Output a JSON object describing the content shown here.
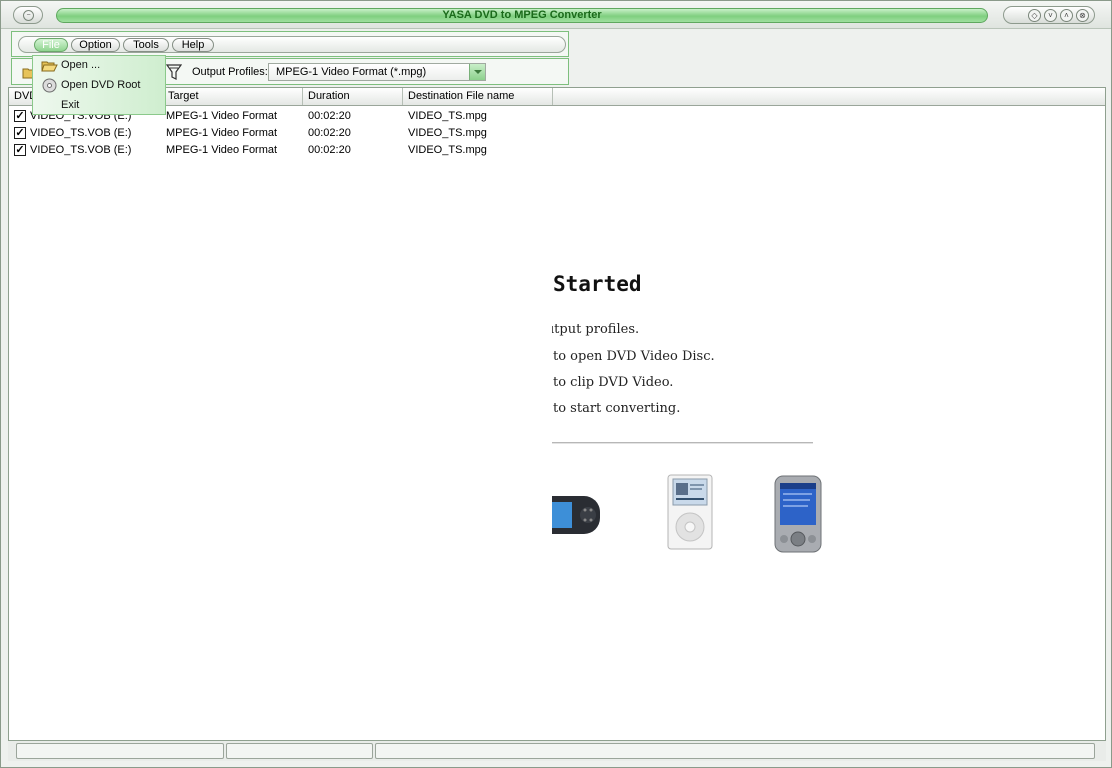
{
  "window": {
    "title": "YASA DVD to MPEG Converter",
    "controls": [
      "sys-menu",
      "minimize",
      "maximize",
      "restore",
      "close"
    ]
  },
  "menu": {
    "file": "File",
    "option": "Option",
    "tools": "Tools",
    "help": "Help"
  },
  "file_menu": {
    "items": [
      "Open ...",
      "Open DVD Root",
      "Exit"
    ]
  },
  "toolbar": {
    "profiles_label": "Output Profiles:",
    "profiles_value": "MPEG-1 Video Format (*.mpg)"
  },
  "list": {
    "columns": [
      "DVD",
      "Target",
      "Duration",
      "Destination File name"
    ],
    "rows": [
      {
        "checked": true,
        "source": "VIDEO_TS.VOB (E:)",
        "target": "MPEG-1 Video Format",
        "duration": "00:02:20",
        "dest": "VIDEO_TS.mpg"
      },
      {
        "checked": true,
        "source": "VIDEO_TS.VOB (E:)",
        "target": "MPEG-1 Video Format",
        "duration": "00:02:20",
        "dest": "VIDEO_TS.mpg"
      },
      {
        "checked": true,
        "source": "VIDEO_TS.VOB (E:)",
        "target": "MPEG-1 Video Format",
        "duration": "00:02:20",
        "dest": "VIDEO_TS.mpg"
      }
    ]
  },
  "getting_started": {
    "title": "Started",
    "lines": [
      "ıtput profiles.",
      "to open DVD Video Disc.",
      "to clip DVD Video.",
      "to start converting."
    ]
  },
  "icons": {
    "open": "folder-open-icon",
    "dvd_root": "dvd-disc-icon",
    "filter": "filter-icon",
    "devices": [
      "psp-device-icon",
      "ipod-device-icon",
      "pocket-pc-device-icon"
    ]
  },
  "colors": {
    "accent_green": "#7fcf7f",
    "title_text": "#1a6a1a"
  }
}
